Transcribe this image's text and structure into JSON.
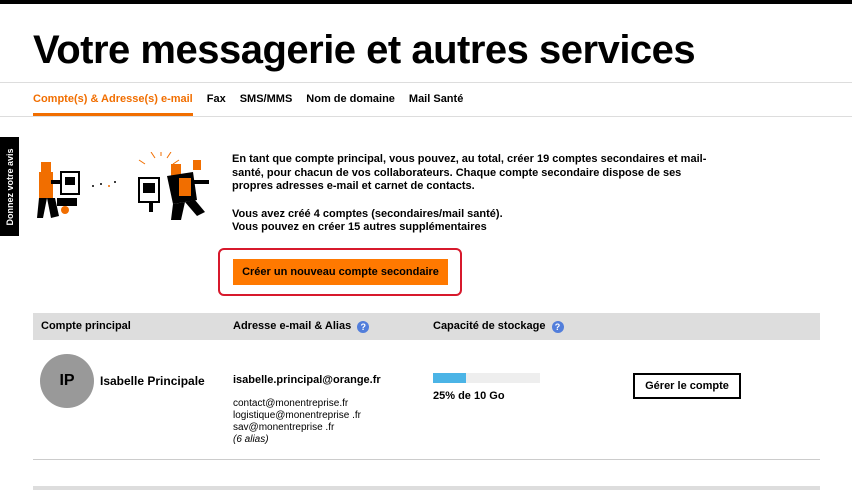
{
  "page": {
    "title": "Votre messagerie et autres services"
  },
  "tabs": [
    {
      "label": "Compte(s) & Adresse(s) e-mail",
      "active": true
    },
    {
      "label": "Fax",
      "active": false
    },
    {
      "label": "SMS/MMS",
      "active": false
    },
    {
      "label": "Nom de domaine",
      "active": false
    },
    {
      "label": "Mail Santé",
      "active": false
    }
  ],
  "feedback": {
    "label": "Donnez votre avis"
  },
  "intro": {
    "paragraph1": "En tant que compte principal, vous pouvez, au total, créer 19 comptes secondaires et mail-santé, pour chacun de vos collaborateurs. Chaque compte secondaire dispose de ses propres adresses e-mail et carnet de contacts.",
    "paragraph2_line1": "Vous avez créé 4 comptes (secondaires/mail santé).",
    "paragraph2_line2": "Vous pouvez en créer 15 autres supplémentaires"
  },
  "create_button": {
    "label": "Créer un nouveau compte secondaire"
  },
  "table": {
    "headers": {
      "account": "Compte principal",
      "email": "Adresse e-mail & Alias",
      "storage": "Capacité de stockage"
    },
    "help_icon": "?",
    "rows": [
      {
        "initials": "IP",
        "name": "Isabelle Principale",
        "email": "isabelle.principal@orange.fr",
        "aliases": [
          "contact@monentreprise.fr",
          "logistique@monentreprise .fr",
          "sav@monentreprise .fr"
        ],
        "alias_count": "(6 alias)",
        "storage_fraction": 0.31,
        "storage_text": "25% de 10 Go",
        "manage_label": "Gérer le compte"
      }
    ]
  },
  "colors": {
    "accent": "#f16e00",
    "button": "#ff7900",
    "highlight": "#d7192c",
    "storage_fill": "#4bb4e6",
    "help_icon": "#527edb"
  },
  "icons": {
    "help": "question-circle-icon",
    "illustration": "people-exchanging-documents-illustration"
  }
}
